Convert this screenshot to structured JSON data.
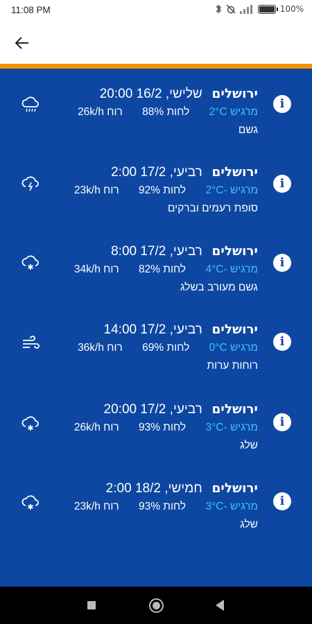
{
  "status_bar": {
    "time": "11:08 PM",
    "battery": "100%"
  },
  "header": {
    "back_icon": "arrow-left-icon"
  },
  "forecast": [
    {
      "city": "ירושלים",
      "datetime": "שלישי, 16/2 20:00",
      "feels": "מרגיש 2°C",
      "humidity": "לחות 88%",
      "wind": "רוח 26k/h",
      "desc": "גשם",
      "icon": "rain-icon"
    },
    {
      "city": "ירושלים",
      "datetime": "רביעי, 17/2 2:00",
      "feels": "מרגיש -2°C",
      "humidity": "לחות 92%",
      "wind": "רוח 23k/h",
      "desc": "סופת רעמים וברקים",
      "icon": "thunderstorm-icon"
    },
    {
      "city": "ירושלים",
      "datetime": "רביעי, 17/2 8:00",
      "feels": "מרגיש -4°C",
      "humidity": "לחות 82%",
      "wind": "רוח 34k/h",
      "desc": "גשם מעורב בשלג",
      "icon": "sleet-icon"
    },
    {
      "city": "ירושלים",
      "datetime": "רביעי, 17/2 14:00",
      "feels": "מרגיש 0°C",
      "humidity": "לחות 69%",
      "wind": "רוח 36k/h",
      "desc": "רוחות ערות",
      "icon": "wind-icon"
    },
    {
      "city": "ירושלים",
      "datetime": "רביעי, 17/2 20:00",
      "feels": "מרגיש -3°C",
      "humidity": "לחות 93%",
      "wind": "רוח 26k/h",
      "desc": "שלג",
      "icon": "snow-icon"
    },
    {
      "city": "ירושלים",
      "datetime": "חמישי, 18/2 2:00",
      "feels": "מרגיש -3°C",
      "humidity": "לחות 93%",
      "wind": "רוח 23k/h",
      "desc": "שלג",
      "icon": "snow-icon"
    }
  ],
  "colors": {
    "background": "#0d47a1",
    "accent": "#f39200",
    "feels": "#39c2ff"
  }
}
